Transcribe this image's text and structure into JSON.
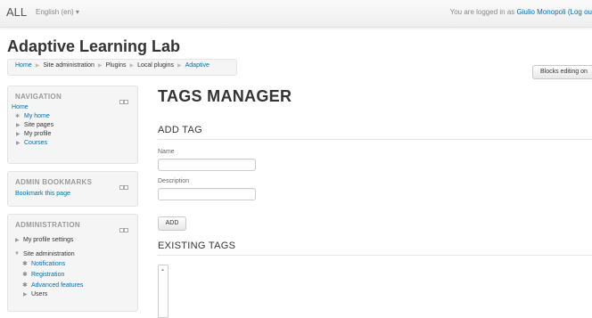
{
  "topbar": {
    "brand": "ALL",
    "language": "English (en) ▾",
    "login_prefix": "You are logged in as ",
    "login_user": "Giulio Monopoli (Log ou"
  },
  "site": {
    "title": "Adaptive Learning Lab"
  },
  "breadcrumb": {
    "items": [
      "Home",
      "Site administration",
      "Plugins",
      "Local plugins",
      "Adaptive"
    ]
  },
  "blocks_editing_label": "Blocks editing on",
  "navigation": {
    "title": "NAVIGATION",
    "home": "Home",
    "my_home": "My home",
    "site_pages": "Site pages",
    "my_profile": "My profile",
    "courses": "Courses"
  },
  "admin_bookmarks": {
    "title": "ADMIN BOOKMARKS",
    "bookmark_link": "Bookmark this page"
  },
  "administration": {
    "title": "ADMINISTRATION",
    "profile_settings": "My profile settings",
    "site_admin": "Site administration",
    "notifications": "Notifications",
    "registration": "Registration",
    "advanced_features": "Advanced features",
    "users": "Users"
  },
  "main": {
    "heading": "TAGS MANAGER",
    "add_tag_heading": "ADD TAG",
    "name_label": "Name",
    "description_label": "Description",
    "add_button": "ADD",
    "existing_heading": "EXISTING TAGS"
  },
  "colors": {
    "link": "#0070a8",
    "text": "#333333",
    "muted": "#999999"
  }
}
